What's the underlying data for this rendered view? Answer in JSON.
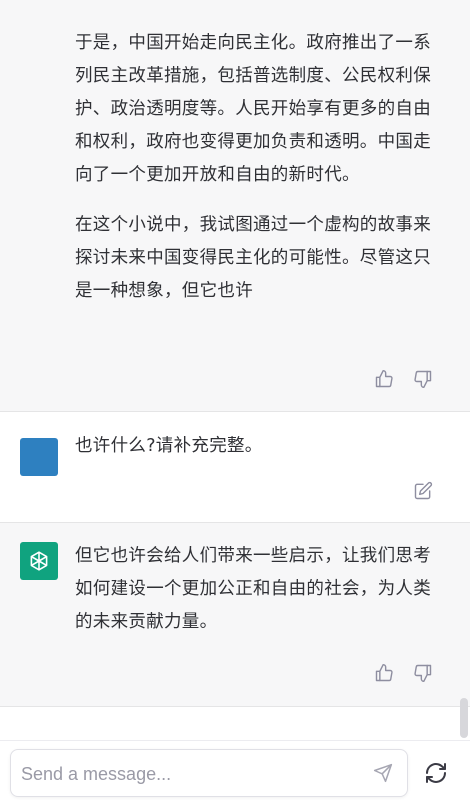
{
  "conversation": {
    "assistant_1": {
      "paragraphs": [
        "于是，中国开始走向民主化。政府推出了一系列民主改革措施，包括普选制度、公民权利保护、政治透明度等。人民开始享有更多的自由和权利，政府也变得更加负责和透明。中国走向了一个更加开放和自由的新时代。",
        "在这个小说中，我试图通过一个虚构的故事来探讨未来中国变得民主化的可能性。尽管这只是一种想象，但它也许"
      ]
    },
    "user_1": {
      "text": "也许什么?请补充完整。"
    },
    "assistant_2": {
      "text": "但它也许会给人们带来一些启示，让我们思考如何建设一个更加公正和自由的社会，为人类的未来贡献力量。"
    }
  },
  "composer": {
    "placeholder": "Send a message..."
  },
  "icons": {
    "thumbs_up": "thumbs-up-icon",
    "thumbs_down": "thumbs-down-icon",
    "edit": "edit-icon",
    "send": "send-icon",
    "regenerate": "regenerate-icon",
    "assistant_logo": "openai-logo-icon"
  },
  "colors": {
    "assistant_bg": "#f7f7f8",
    "user_avatar": "#2e80c0",
    "assistant_avatar": "#10a37f"
  }
}
